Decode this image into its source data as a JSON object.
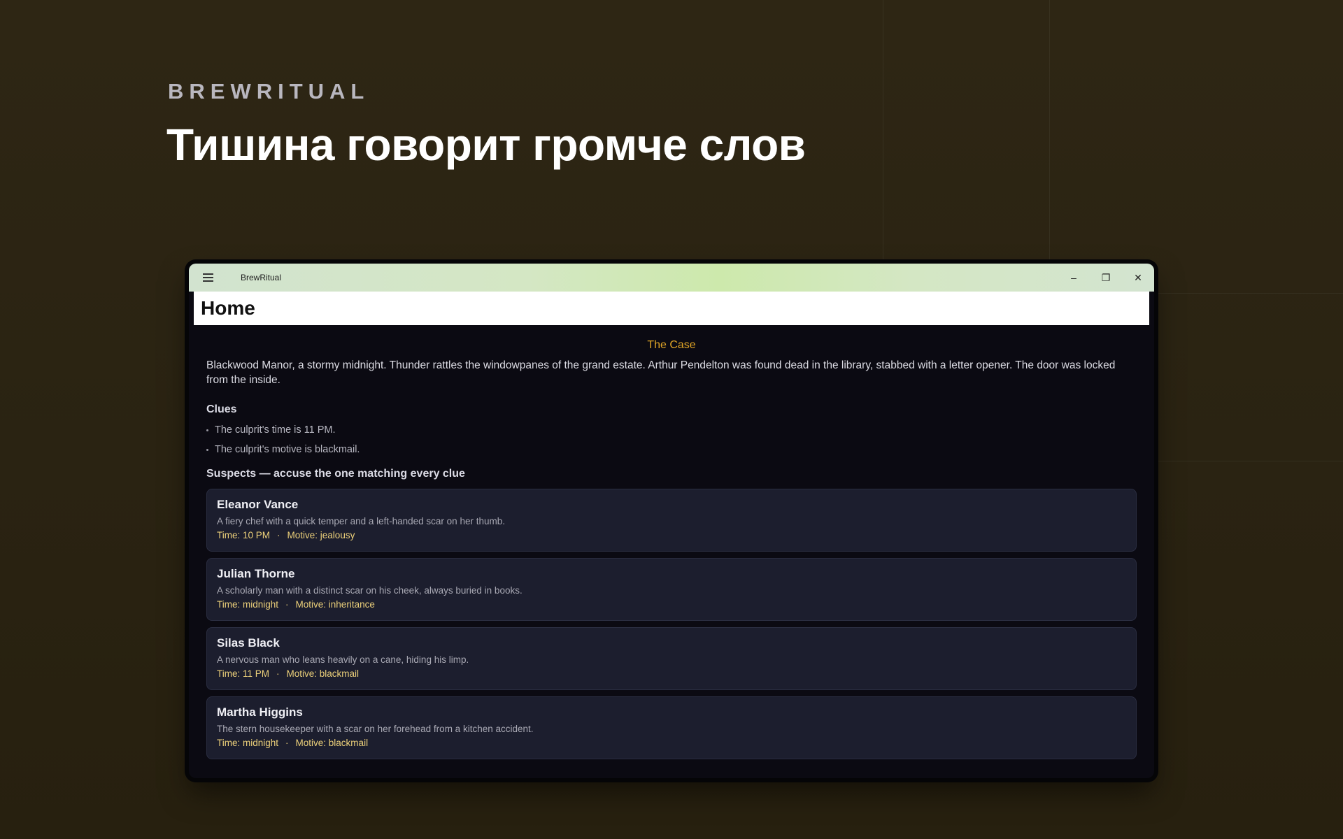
{
  "brand": "BREWRITUAL",
  "headline": "Тишина говорит громче слов",
  "window": {
    "app_title": "BrewRitual",
    "page_title": "Home",
    "controls": {
      "minimize": "–",
      "restore": "❐",
      "close": "✕"
    }
  },
  "case": {
    "title": "The Case",
    "text": "Blackwood Manor, a stormy midnight. Thunder rattles the windowpanes of the grand estate. Arthur Pendelton was found dead in the library, stabbed with a letter opener. The door was locked from the inside."
  },
  "clues": {
    "heading": "Clues",
    "items": [
      "The culprit's time is 11 PM.",
      "The culprit's motive is blackmail."
    ]
  },
  "suspects": {
    "heading": "Suspects — accuse the one matching every clue",
    "items": [
      {
        "name": "Eleanor Vance",
        "desc": "A fiery chef with a quick temper and a left-handed scar on her thumb.",
        "time": "Time: 10 PM",
        "motive": "Motive: jealousy"
      },
      {
        "name": "Julian Thorne",
        "desc": "A scholarly man with a distinct scar on his cheek, always buried in books.",
        "time": "Time: midnight",
        "motive": "Motive: inheritance"
      },
      {
        "name": "Silas Black",
        "desc": "A nervous man who leans heavily on a cane, hiding his limp.",
        "time": "Time: 11 PM",
        "motive": "Motive: blackmail"
      },
      {
        "name": "Martha Higgins",
        "desc": "The stern housekeeper with a scar on her forehead from a kitchen accident.",
        "time": "Time: midnight",
        "motive": "Motive: blackmail"
      }
    ],
    "separator": "·"
  },
  "colors": {
    "accent": "#e0a526",
    "meta": "#ecd07a",
    "card_bg": "#1c1e2e",
    "content_bg": "#0b0a12"
  },
  "icons": {
    "menu": "hamburger-icon",
    "minimize": "minimize-icon",
    "restore": "restore-icon",
    "close": "close-icon"
  }
}
